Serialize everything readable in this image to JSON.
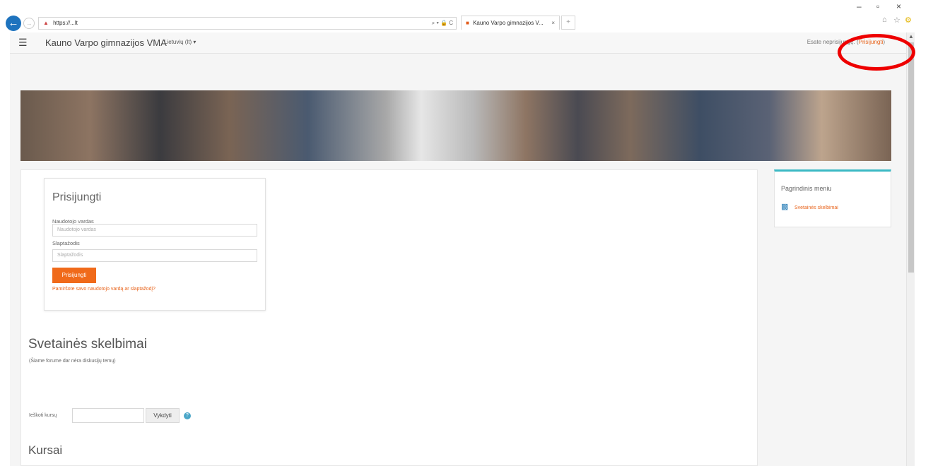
{
  "browser": {
    "address": "https://...lt",
    "tab_title": "Kauno Varpo gimnazijos V...",
    "tab_close": "×",
    "address_tools": "⌕ ▾ 🔒 C",
    "window_controls": [
      "–",
      "▫",
      "×"
    ]
  },
  "navbar": {
    "menu_icon": "hamburger-icon",
    "site_name": "Kauno Varpo gimnazijos VMA",
    "language": "Lietuvių (lt) ▾",
    "login_info_prefix": "Esate neprisijungę. (",
    "login_link": "Prisijungti",
    "login_info_suffix": ")"
  },
  "login": {
    "title": "Prisijungti",
    "username_label": "Naudotojo vardas",
    "username_placeholder": "Naudotojo vardas",
    "password_label": "Slaptažodis",
    "password_placeholder": "Slaptažodis",
    "submit": "Prisijungti",
    "forgot": "Pamiršote savo naudotojo vardą ar slaptažodį?"
  },
  "news": {
    "heading": "Svetainės skelbimai",
    "empty": "(Šiame forume dar nėra diskusijų temų)"
  },
  "course_search": {
    "label": "Ieškoti kursų",
    "button": "Vykdyti",
    "help_icon": "help-icon"
  },
  "courses": {
    "heading": "Kursai"
  },
  "block_main_menu": {
    "title": "Pagrindinis meniu",
    "link": "Svetainės skelbimai",
    "link_icon": "chat-icon"
  },
  "annotation": {
    "color": "#ee0000"
  }
}
